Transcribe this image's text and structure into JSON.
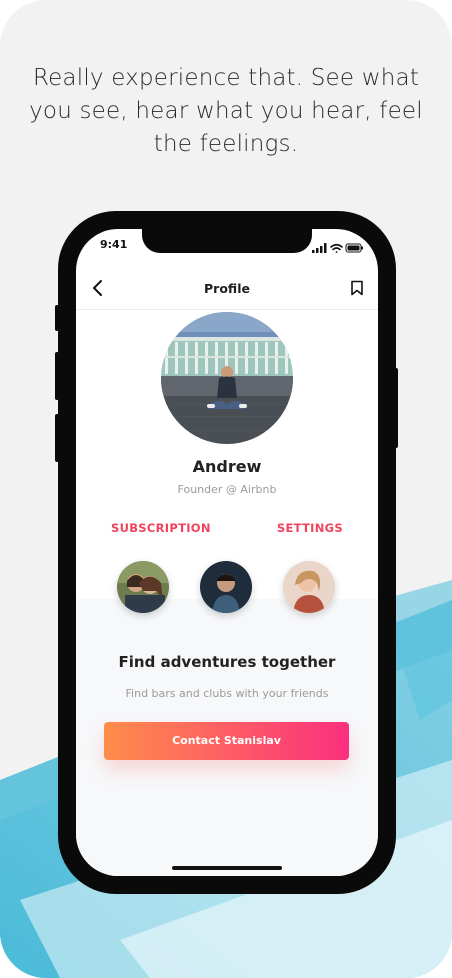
{
  "headline": "Really experience that. See what you see, hear what you hear, feel the feelings.",
  "status_bar": {
    "time": "9:41",
    "icons": [
      "signal-icon",
      "wifi-icon",
      "battery-icon"
    ]
  },
  "nav": {
    "title": "Profile",
    "back_icon": "chevron-left-icon",
    "bookmark_icon": "bookmark-icon"
  },
  "profile": {
    "name": "Andrew",
    "role": "Founder @ Airbnb"
  },
  "links": {
    "subscription": "SUBSCRIPTION",
    "settings": "SETTINGS"
  },
  "friends_count": 3,
  "section": {
    "title": "Find adventures together",
    "subtitle": "Find bars and clubs with your friends"
  },
  "cta": {
    "label": "Contact Stanislav"
  },
  "colors": {
    "accent": "#f0445e",
    "gradient_start": "#ff8d4a",
    "gradient_end": "#fb2f7f",
    "brush": "#3fb7d6",
    "background": "#f2f2f2"
  }
}
